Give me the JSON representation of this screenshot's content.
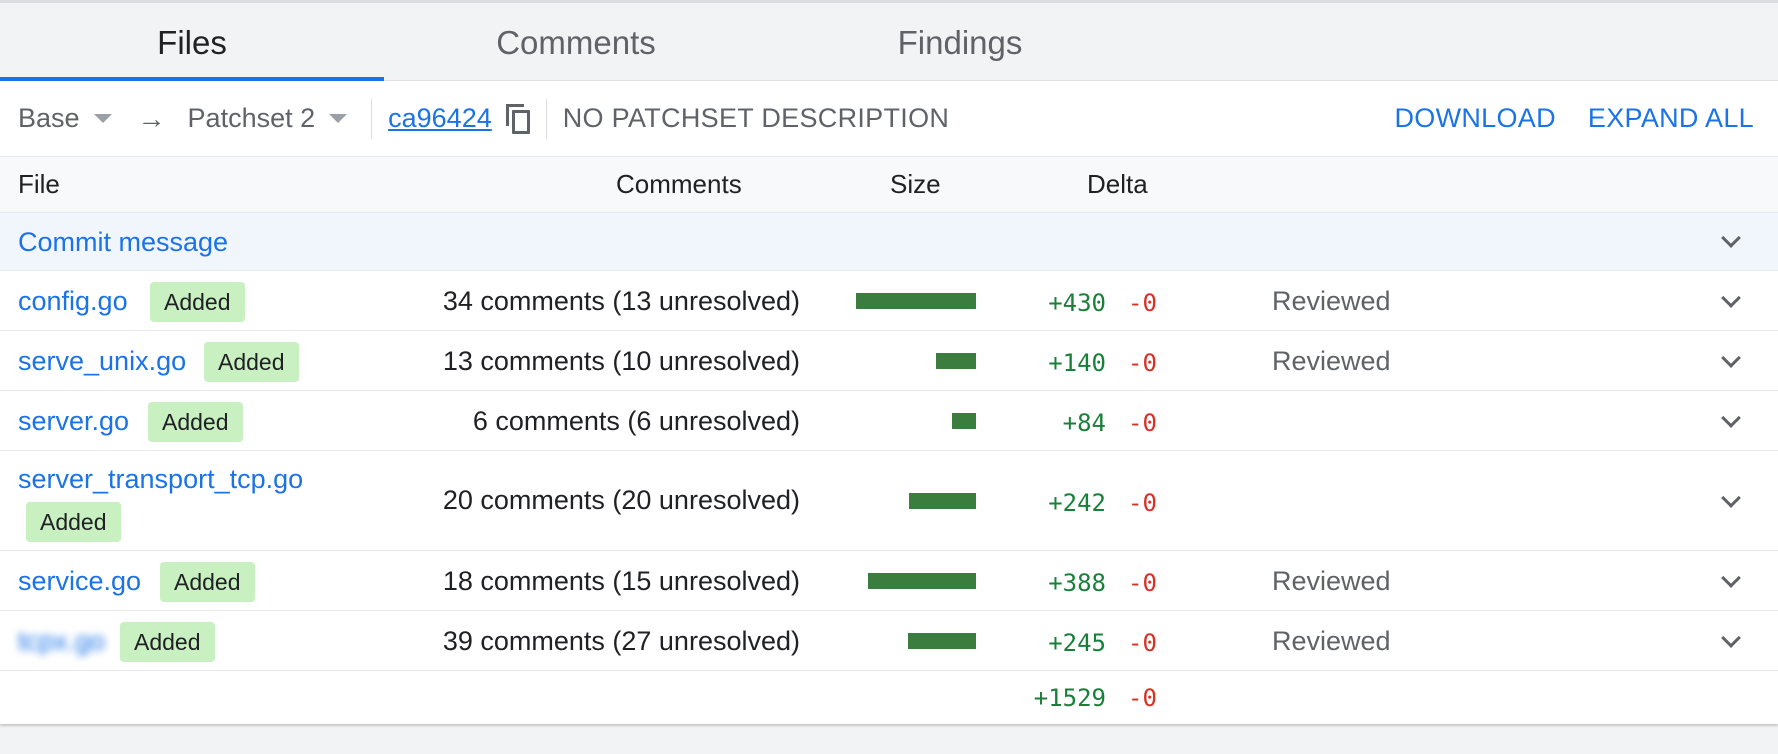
{
  "tabs": [
    {
      "label": "Files"
    },
    {
      "label": "Comments"
    },
    {
      "label": "Findings"
    }
  ],
  "patchset": {
    "base": "Base",
    "arrow": "→",
    "target": "Patchset 2",
    "hash": "ca96424",
    "description": "NO PATCHSET DESCRIPTION",
    "download": "DOWNLOAD",
    "expand_all": "EXPAND ALL"
  },
  "table": {
    "headers": {
      "file": "File",
      "comments": "Comments",
      "size": "Size",
      "delta": "Delta"
    },
    "commit_message": "Commit message",
    "rows": [
      {
        "file": "config.go",
        "badge": "Added",
        "comments": "34 comments (13 unresolved)",
        "size_fraction": 1.0,
        "plus": "+430",
        "minus": "-0",
        "status": "Reviewed"
      },
      {
        "file": "serve_unix.go",
        "badge": "Added",
        "comments": "13 comments (10 unresolved)",
        "size_fraction": 0.33,
        "plus": "+140",
        "minus": "-0",
        "status": "Reviewed"
      },
      {
        "file": "server.go",
        "badge": "Added",
        "comments": "6 comments (6 unresolved)",
        "size_fraction": 0.2,
        "plus": "+84",
        "minus": "-0",
        "status": ""
      },
      {
        "file": "server_transport_tcp.go",
        "badge": "Added",
        "comments": "20 comments (20 unresolved)",
        "size_fraction": 0.56,
        "plus": "+242",
        "minus": "-0",
        "status": ""
      },
      {
        "file": "service.go",
        "badge": "Added",
        "comments": "18 comments (15 unresolved)",
        "size_fraction": 0.9,
        "plus": "+388",
        "minus": "-0",
        "status": "Reviewed"
      },
      {
        "file": "tcpx.go",
        "badge": "Added",
        "comments": "39 comments (27 unresolved)",
        "size_fraction": 0.57,
        "plus": "+245",
        "minus": "-0",
        "status": "Reviewed"
      }
    ],
    "total": {
      "plus": "+1529",
      "minus": "-0"
    }
  }
}
